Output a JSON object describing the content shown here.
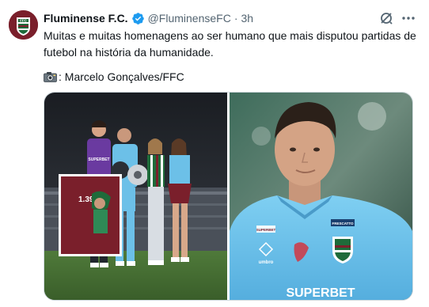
{
  "tweet": {
    "author_name": "Fluminense F.C.",
    "handle": "@FluminenseFC",
    "separator": "·",
    "time": "3h",
    "text_line1": "Muitas e muitas homenagens ao ser humano que mais disputou partidas de",
    "text_line2": "futebol na história da humanidade.",
    "credit": ": Marcelo Gonçalves/FFC"
  },
  "icons": {
    "avatar": "fluminense-crest-avatar",
    "verified": "verified-badge-icon",
    "grok": "grok-icon",
    "more": "more-options-icon",
    "camera": "camera-icon"
  },
  "colors": {
    "verified_blue": "#1d9bf0",
    "secondary_text": "#536471",
    "club_grena": "#7a1f2b",
    "club_green": "#1e6b3a"
  },
  "media": {
    "left_photo": {
      "shirt_text": "SUPERBET",
      "frame_text": "1.391"
    },
    "right_photo": {
      "sponsor_1": "FRESCATTO",
      "sponsor_2": "SUPERBET",
      "sponsor_3": "SUPERBET",
      "brand": "umbro"
    }
  }
}
